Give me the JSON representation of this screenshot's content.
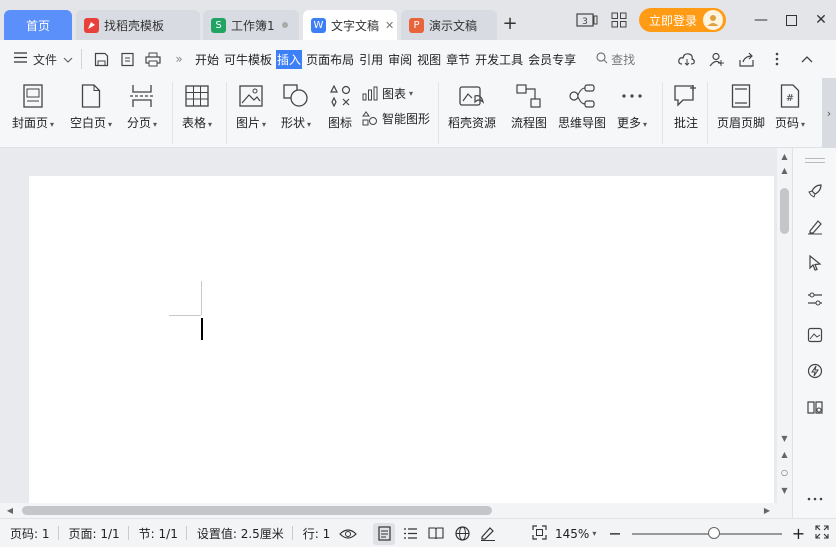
{
  "tabs": {
    "home": "首页",
    "items": [
      {
        "label": "找稻壳模板",
        "icon": "daoke-icon",
        "color": "#e8403a"
      },
      {
        "label": "工作簿1",
        "icon": "spreadsheet-icon",
        "color": "#20a464"
      },
      {
        "label": "文字文稿",
        "icon": "writer-icon",
        "color": "#3d7ff5"
      },
      {
        "label": "演示文稿",
        "icon": "presentation-icon",
        "color": "#e8643a"
      }
    ],
    "add": "+",
    "window_badge": "3",
    "login": "立即登录"
  },
  "menu": {
    "file": "文件",
    "items": [
      "开始",
      "可牛模板",
      "插入",
      "页面布局",
      "引用",
      "审阅",
      "视图",
      "章节",
      "开发工具",
      "会员专享"
    ],
    "active": "插入",
    "search": "查找"
  },
  "ribbon": {
    "cover": "封面页",
    "blank": "空白页",
    "page_break": "分页",
    "table": "表格",
    "picture": "图片",
    "shape": "形状",
    "icons": "图标",
    "chart": "图表",
    "smart_art": "智能图形",
    "daoke": "稻壳资源",
    "flowchart": "流程图",
    "mindmap": "思维导图",
    "more": "更多",
    "comment": "批注",
    "header_footer": "页眉页脚",
    "page_number": "页码"
  },
  "status": {
    "page_num": "页码: 1",
    "pages": "页面: 1/1",
    "section": "节: 1/1",
    "setting": "设置值: 2.5厘米",
    "line": "行: 1",
    "zoom": "145%",
    "zoom_level": 0.55
  }
}
